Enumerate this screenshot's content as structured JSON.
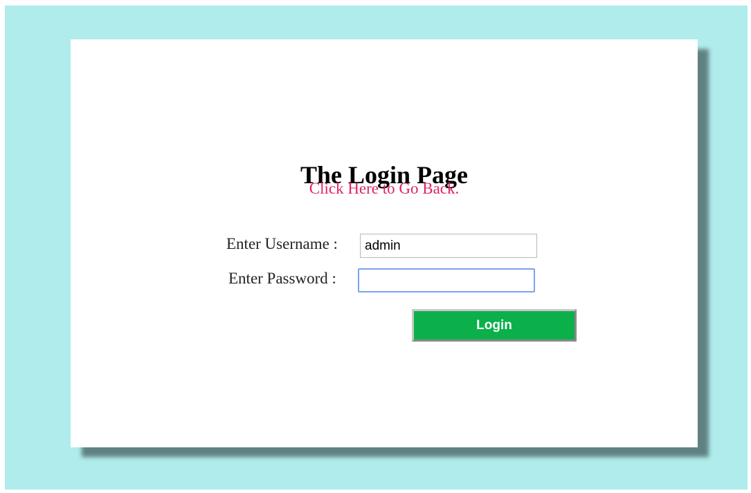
{
  "page": {
    "title": "The Login Page",
    "back_link": "Click Here to Go Back."
  },
  "form": {
    "username_label": "Enter Username :",
    "username_value": "admin",
    "password_label": "Enter Password :",
    "password_value": "",
    "login_label": "Login"
  },
  "colors": {
    "background": "#b0ecec",
    "link": "#e0245e",
    "button": "#0bb04a"
  }
}
